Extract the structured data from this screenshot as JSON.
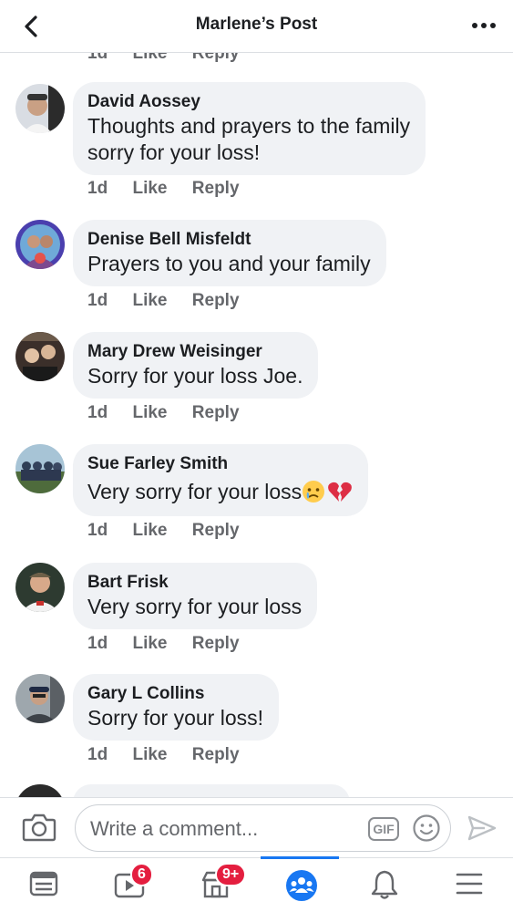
{
  "header": {
    "title": "Marlene’s Post",
    "back_icon": "chevron-left-icon",
    "more_icon": "more-horizontal-icon"
  },
  "cut_comment": {
    "time": "1d",
    "like": "Like",
    "reply": "Reply"
  },
  "comments": [
    {
      "author": "David Aossey",
      "text_lines": [
        "Thoughts and prayers to the family",
        "sorry for your loss!"
      ],
      "time": "1d",
      "like": "Like",
      "reply": "Reply"
    },
    {
      "author": "Denise Bell Misfeldt",
      "text_lines": [
        "Prayers to you and your family"
      ],
      "time": "1d",
      "like": "Like",
      "reply": "Reply"
    },
    {
      "author": "Mary Drew Weisinger",
      "text_lines": [
        "Sorry for your loss Joe."
      ],
      "time": "1d",
      "like": "Like",
      "reply": "Reply"
    },
    {
      "author": "Sue Farley Smith",
      "text_lines": [
        "Very sorry for your loss"
      ],
      "emojis": [
        "crying-face-emoji",
        "broken-heart-emoji"
      ],
      "time": "1d",
      "like": "Like",
      "reply": "Reply"
    },
    {
      "author": "Bart Frisk",
      "text_lines": [
        "Very sorry for your loss"
      ],
      "time": "1d",
      "like": "Like",
      "reply": "Reply"
    },
    {
      "author": "Gary L Collins",
      "text_lines": [
        "Sorry for your loss!"
      ],
      "time": "1d",
      "like": "Like",
      "reply": "Reply"
    }
  ],
  "composer": {
    "placeholder": "Write a comment...",
    "gif_label": "GIF",
    "camera_icon": "camera-icon",
    "emoji_icon": "smiley-icon",
    "send_icon": "send-icon"
  },
  "bottom_nav": {
    "items": [
      {
        "name": "news-feed-icon"
      },
      {
        "name": "watch-icon",
        "badge": "6"
      },
      {
        "name": "marketplace-icon",
        "badge": "9+"
      },
      {
        "name": "groups-icon",
        "active": true
      },
      {
        "name": "notifications-bell-icon"
      },
      {
        "name": "menu-icon"
      }
    ],
    "accent": "#1877f2",
    "badge_color": "#e41e3f"
  }
}
